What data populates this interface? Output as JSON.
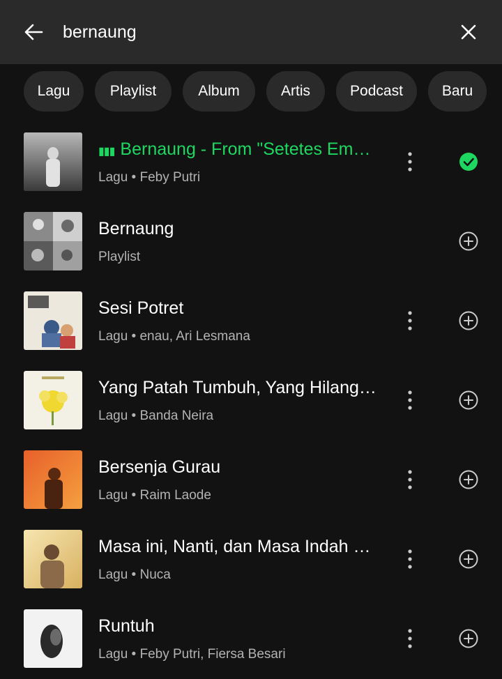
{
  "search": {
    "query": "bernaung"
  },
  "filters": [
    "Lagu",
    "Playlist",
    "Album",
    "Artis",
    "Podcast",
    "Baru"
  ],
  "results": [
    {
      "title": "Bernaung - From \"Setetes Embun\"",
      "subtitle": "Lagu • Feby Putri",
      "playing": true,
      "has_more": true,
      "action": "check-icon"
    },
    {
      "title": "Bernaung",
      "subtitle": "Playlist",
      "playing": false,
      "has_more": false,
      "action": "add-icon"
    },
    {
      "title": "Sesi Potret",
      "subtitle": "Lagu • enau, Ari Lesmana",
      "playing": false,
      "has_more": true,
      "action": "add-icon"
    },
    {
      "title": "Yang Patah Tumbuh, Yang Hilang Berganti",
      "subtitle": "Lagu • Banda Neira",
      "playing": false,
      "has_more": true,
      "action": "add-icon"
    },
    {
      "title": "Bersenja Gurau",
      "subtitle": "Lagu • Raim Laode",
      "playing": false,
      "has_more": true,
      "action": "add-icon"
    },
    {
      "title": "Masa ini, Nanti, dan Masa Indah Lainnya",
      "subtitle": "Lagu • Nuca",
      "playing": false,
      "has_more": true,
      "action": "add-icon"
    },
    {
      "title": "Runtuh",
      "subtitle": "Lagu • Feby Putri, Fiersa Besari",
      "playing": false,
      "has_more": true,
      "action": "add-icon"
    }
  ],
  "colors": {
    "accent": "#1ed760",
    "background": "#121212",
    "header": "#2a2a2a"
  }
}
